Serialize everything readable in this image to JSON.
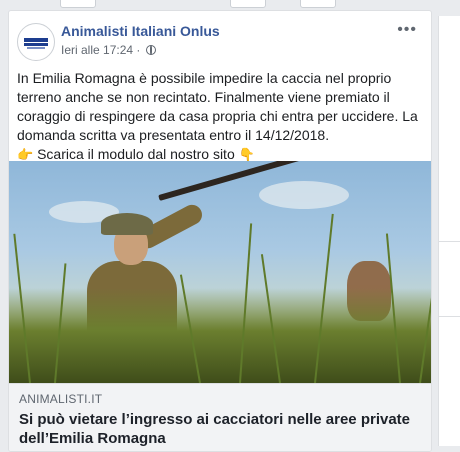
{
  "post": {
    "page_name": "Animalisti Italiani Onlus",
    "timestamp": "Ieri alle 17:24 ·",
    "more_label": "•••",
    "avatar_logo": "ANIMALISTI ITALIANI",
    "body": "In Emilia Romagna è possibile impedire la caccia nel proprio terreno anche se non recintato. Finalmente viene premiato il coraggio di respingere da casa propria chi entra per uccidere. La domanda scritta va presentata entro il 14/12/2018.",
    "cta_text": "Scarica il modulo dal nostro sito",
    "cta_icon_left": "point-right-emoji",
    "cta_icon_right": "point-down-emoji"
  },
  "link_preview": {
    "domain": "ANIMALISTI.IT",
    "title": "Si può vietare l’ingresso ai cacciatori nelle aree private dell’Emilia Romagna",
    "image": "hunter-in-tall-grass-photo"
  },
  "colors": {
    "page_name": "#385898",
    "link_bg": "#f2f3f5",
    "background": "#e9ebee"
  }
}
